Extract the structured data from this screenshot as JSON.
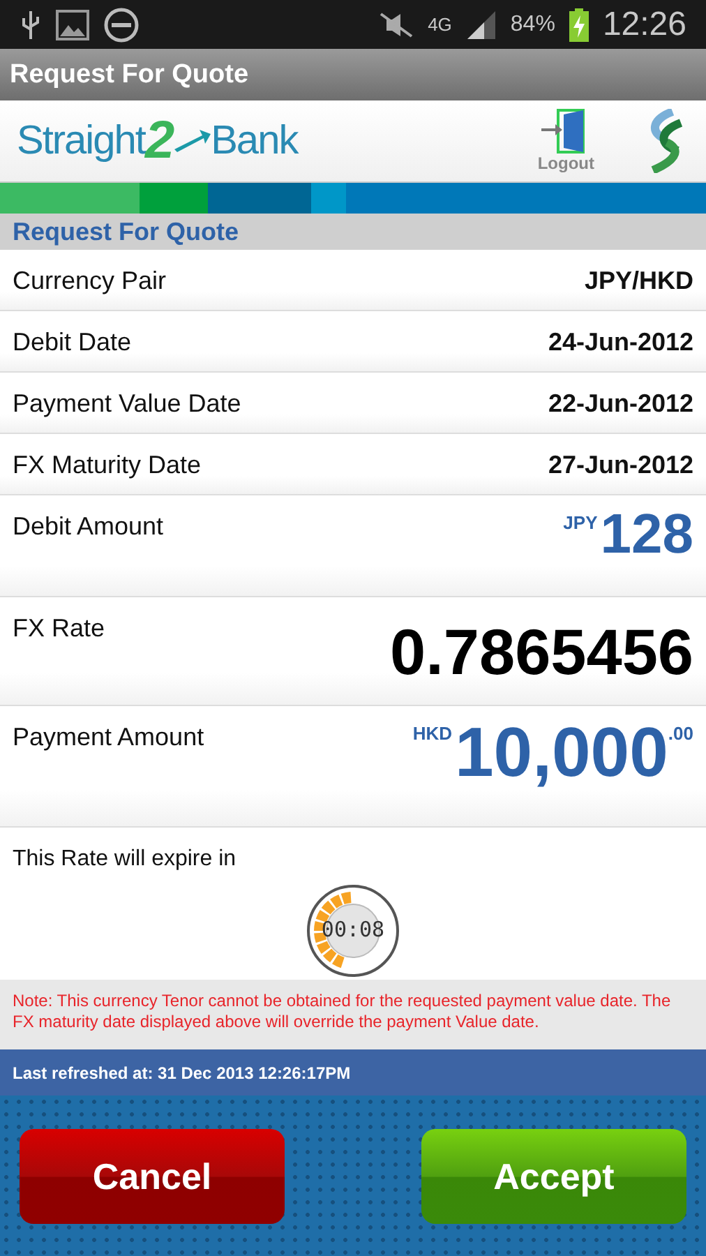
{
  "status_bar": {
    "network": "4G",
    "battery": "84%",
    "time": "12:26"
  },
  "title_bar": {
    "title": "Request For Quote"
  },
  "header": {
    "logo": {
      "left": "Straight",
      "mark": "2",
      "right": "Bank"
    },
    "logout": "Logout"
  },
  "section_title": "Request For Quote",
  "rows": [
    {
      "kind": "simple",
      "label": "Currency Pair",
      "value": "JPY/HKD"
    },
    {
      "kind": "simple",
      "label": "Debit Date",
      "value": "24-Jun-2012"
    },
    {
      "kind": "simple",
      "label": "Payment Value Date",
      "value": "22-Jun-2012"
    },
    {
      "kind": "simple",
      "label": "FX Maturity Date",
      "value": "27-Jun-2012"
    },
    {
      "kind": "amount",
      "label": "Debit Amount",
      "currency": "JPY",
      "value": "128"
    },
    {
      "kind": "rate",
      "label": "FX Rate",
      "value": "0.7865456"
    },
    {
      "kind": "amount",
      "label": "Payment Amount",
      "currency": "HKD",
      "value": "10,000",
      "decimals": ".00"
    }
  ],
  "expiry": {
    "label": "This Rate will expire in",
    "timer": "00:08"
  },
  "note": "Note: This currency Tenor cannot be obtained for the requested payment value date. The FX maturity date displayed above will override the payment Value date.",
  "last_refreshed": "Last refreshed at: 31 Dec 2013 12:26:17PM",
  "buttons": [
    {
      "kind": "cancel",
      "label": "Cancel"
    },
    {
      "kind": "accept",
      "label": "Accept"
    }
  ]
}
